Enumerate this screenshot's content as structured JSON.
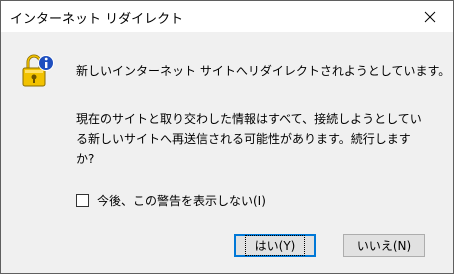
{
  "window": {
    "title": "インターネット リダイレクト"
  },
  "icons": {
    "close": "close-icon",
    "lock": "padlock-info-icon"
  },
  "message": {
    "heading": "新しいインターネット サイトへリダイレクトされようとしています。",
    "body_lines": [
      "現在のサイトと取り交わした情報はすべて、接続しようとしてい",
      "る新しいサイトへ再送信される可能性があります。続行します",
      "か?"
    ]
  },
  "checkbox": {
    "label": "今後、この警告を表示しない(I)",
    "checked": false
  },
  "buttons": {
    "yes_label": "はい(Y)",
    "no_label": "いいえ(N)"
  },
  "colors": {
    "accent": "#0078d7",
    "dialog_bg": "#f0f0f0",
    "icon_yellow": "#f2c200",
    "icon_blue": "#1f4fbf"
  }
}
